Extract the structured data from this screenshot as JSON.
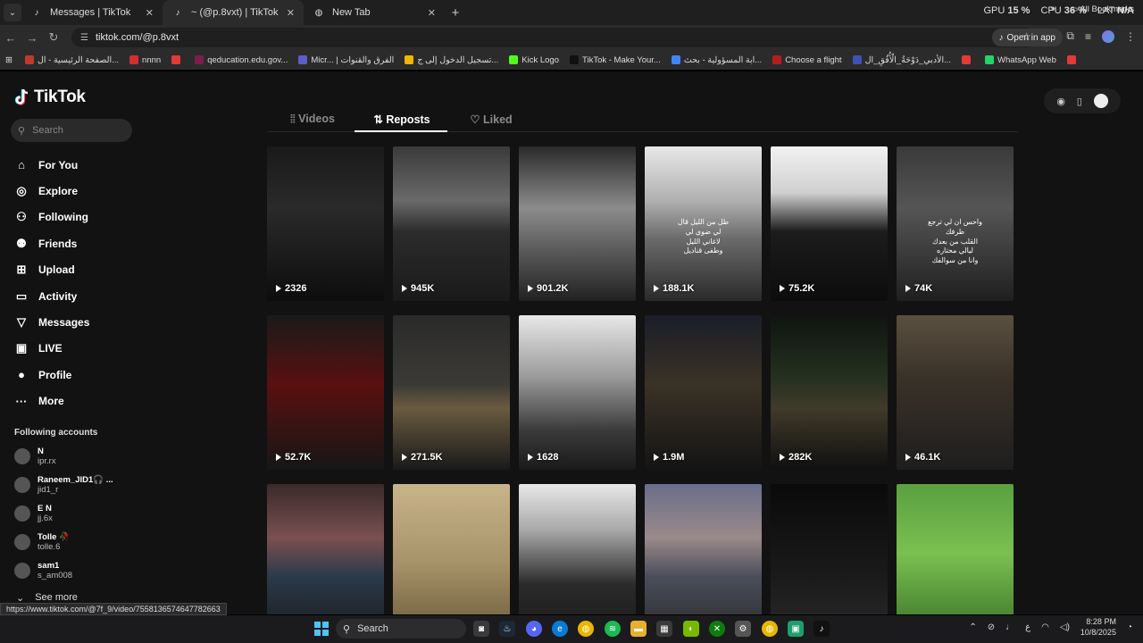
{
  "browser": {
    "tabs": [
      {
        "title": "Messages | TikTok",
        "active": false
      },
      {
        "title": "~ (@p.8vxt) | TikTok",
        "active": true
      },
      {
        "title": "New Tab",
        "active": false
      }
    ],
    "sysmon": {
      "gpu_label": "GPU",
      "gpu_value": "15 %",
      "cpu_label": "CPU",
      "cpu_value": "36 %",
      "lat_label": "LAT",
      "lat_value": "N/A"
    },
    "url": "tiktok.com/@p.8vxt",
    "open_in_app": "Open in app",
    "bookmarks": [
      {
        "label": "الصفحة الرئيسية - ال...",
        "color": "#c0392b"
      },
      {
        "label": "nnnn",
        "color": "#d32f2f"
      },
      {
        "label": "",
        "color": "#e53935"
      },
      {
        "label": "qeducation.edu.gov...",
        "color": "#7b1f4a"
      },
      {
        "label": "Micr... | الفرق والقنوات",
        "color": "#5b5fc7"
      },
      {
        "label": "تسجيل الدخول إلى ج...",
        "color": "#f4b400"
      },
      {
        "label": "Kick Logo",
        "color": "#53fc18"
      },
      {
        "label": "TikTok - Make Your...",
        "color": "#111111"
      },
      {
        "label": "ابة المسؤولية - بحث...",
        "color": "#4285f4"
      },
      {
        "label": "Choose a flight",
        "color": "#b71c1c"
      },
      {
        "label": "الأدبي_دَوْحَةُ_الْأُفُقِ_ال...",
        "color": "#3f51b5"
      },
      {
        "label": "",
        "color": "#e53935"
      },
      {
        "label": "WhatsApp Web",
        "color": "#25d366"
      },
      {
        "label": "",
        "color": "#e53935"
      }
    ],
    "all_bookmarks": "All Bookmarks"
  },
  "tiktok": {
    "logo": "TikTok",
    "search_placeholder": "Search",
    "nav": [
      {
        "label": "For You",
        "icon": "home-icon",
        "glyph": "⌂"
      },
      {
        "label": "Explore",
        "icon": "compass-icon",
        "glyph": "◎"
      },
      {
        "label": "Following",
        "icon": "following-icon",
        "glyph": "⚇"
      },
      {
        "label": "Friends",
        "icon": "friends-icon",
        "glyph": "⚉"
      },
      {
        "label": "Upload",
        "icon": "upload-icon",
        "glyph": "⊞"
      },
      {
        "label": "Activity",
        "icon": "activity-icon",
        "glyph": "▭"
      },
      {
        "label": "Messages",
        "icon": "messages-icon",
        "glyph": "▽"
      },
      {
        "label": "LIVE",
        "icon": "live-icon",
        "glyph": "▣"
      },
      {
        "label": "Profile",
        "icon": "profile-icon",
        "glyph": "●"
      },
      {
        "label": "More",
        "icon": "more-icon",
        "glyph": "···"
      }
    ],
    "following_title": "Following accounts",
    "accounts": [
      {
        "name": "N",
        "handle": "ipr.rx"
      },
      {
        "name": "Raneem_JID1🎧 ...",
        "handle": "jid1_r"
      },
      {
        "name": "E N",
        "handle": "jj.6x"
      },
      {
        "name": "Tolle 🥀",
        "handle": "tolle.6"
      },
      {
        "name": "sam1",
        "handle": "s_am008"
      }
    ],
    "see_more": "See more",
    "profile_tabs": [
      {
        "label": "Videos",
        "glyph": "⦙⦙",
        "active": false
      },
      {
        "label": "Reposts",
        "glyph": "⇅",
        "active": true
      },
      {
        "label": "Liked",
        "glyph": "♡",
        "active": false
      }
    ],
    "videos": [
      {
        "views": "2326",
        "bg": "linear-gradient(180deg,#1a1a1a 0%,#2a2a2a 40%,#0d0d0d 100%)",
        "text": ""
      },
      {
        "views": "945K",
        "bg": "linear-gradient(180deg,#3a3a3a 0%,#6a6a6a 35%,#2c2c2c 55%,#1a1a1a 100%)",
        "text": ""
      },
      {
        "views": "901.2K",
        "bg": "linear-gradient(180deg,#2a2a2a 0%,#8c8c8c 40%,#555 70%,#222 100%)",
        "text": ""
      },
      {
        "views": "188.1K",
        "bg": "linear-gradient(180deg,#e8e8e8 0%,#b0b0b0 35%,#6a6a6a 60%,#2a2a2a 100%)",
        "text": "طل من الليل قال\nلي ضوي لي\nلاغاني الليل\nوطفى قناديل"
      },
      {
        "views": "75.2K",
        "bg": "linear-gradient(180deg,#f2f2f2 0%,#d0d0d0 30%,#1c1c1c 55%,#0c0c0c 100%)",
        "text": ""
      },
      {
        "views": "74K",
        "bg": "linear-gradient(180deg,#3a3a3a 0%,#555 40%,#1f1f1f 100%)",
        "text": "واحس ان لي ترجع\nظرفك\nالقلب من بعدك\nليالي محتاره\nوانا من سوالفك"
      },
      {
        "views": "52.7K",
        "bg": "linear-gradient(180deg,#1a1a1a 0%,#5a1010 45%,#161616 100%)",
        "text": ""
      },
      {
        "views": "271.5K",
        "bg": "linear-gradient(180deg,#2a2a2a 0%,#3c3a36 45%,#6a5a40 60%,#1a1a1a 100%)",
        "text": ""
      },
      {
        "views": "1628",
        "bg": "linear-gradient(180deg,#e8e8e8 0%,#9a9a9a 40%,#3a3a3a 75%,#1a1a1a 100%)",
        "text": ""
      },
      {
        "views": "1.9M",
        "bg": "linear-gradient(180deg,#1a1e28 0%,#3a3226 45%,#141414 100%)",
        "text": ""
      },
      {
        "views": "282K",
        "bg": "linear-gradient(180deg,#0f1410 0%,#24301f 40%,#403a2a 60%,#101010 100%)",
        "text": ""
      },
      {
        "views": "46.1K",
        "bg": "linear-gradient(180deg,#5a5040 0%,#3a3228 40%,#1e1e1e 100%)",
        "text": ""
      },
      {
        "views": "",
        "bg": "linear-gradient(180deg,#3a2a2a 0%,#7a5050 35%,#2a3a4a 60%,#1a1a1a 100%)",
        "text": ""
      },
      {
        "views": "",
        "bg": "linear-gradient(180deg,#c8b48a 0%,#a8946a 50%,#6a5a3a 100%)",
        "text": ""
      },
      {
        "views": "",
        "bg": "linear-gradient(180deg,#e8e8e8 0%,#a8a8a8 30%,#2a2a2a 65%,#1a1a1a 100%)",
        "text": ""
      },
      {
        "views": "",
        "bg": "linear-gradient(180deg,#6a6e8a 0%,#9a8a8a 35%,#4a4e5a 60%,#2a2a2a 100%)",
        "text": ""
      },
      {
        "views": "",
        "bg": "linear-gradient(180deg,#0a0a0a 0%,#1a1a1a 60%,#2a2a2a 100%)",
        "text": ""
      },
      {
        "views": "",
        "bg": "linear-gradient(180deg,#5aa040 0%,#7ac050 45%,#3a7028 100%)",
        "text": ""
      }
    ]
  },
  "status_url": "https://www.tiktok.com/@7f_9/video/7558136574647782663",
  "taskbar": {
    "search": "Search",
    "lang": "ع",
    "time": "8:28 PM",
    "date": "10/8/2025"
  }
}
